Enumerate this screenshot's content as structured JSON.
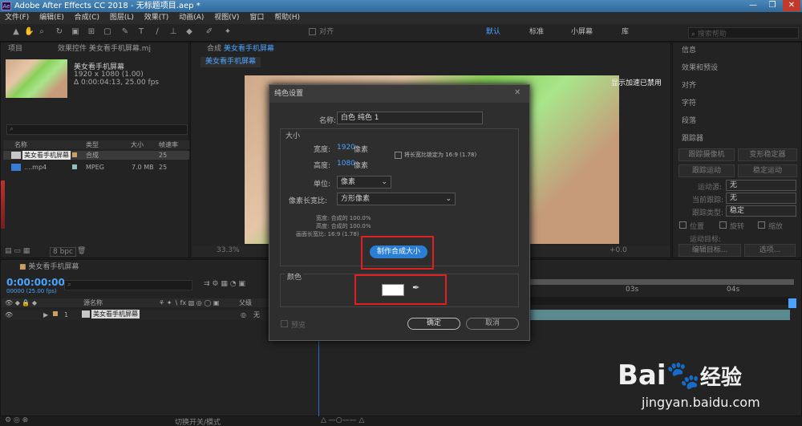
{
  "window": {
    "app_icon": "Ae",
    "title": "Adobe After Effects CC 2018 - 无标题项目.aep *",
    "minimize": "—",
    "maximize": "❐",
    "close": "✕"
  },
  "menu": [
    "文件(F)",
    "编辑(E)",
    "合成(C)",
    "图层(L)",
    "效果(T)",
    "动画(A)",
    "视图(V)",
    "窗口",
    "帮助(H)"
  ],
  "toolbar": {
    "align_label": "对齐",
    "workspaces": [
      "默认",
      "标准",
      "小屏幕",
      "库"
    ],
    "search_placeholder": "搜索帮助"
  },
  "project_panel": {
    "tab_project": "项目",
    "tab_effects": "效果控件 美女看手机屏幕.mj",
    "comp_name": "美女看手机屏幕",
    "comp_res": "1920 x 1080 (1.00)",
    "comp_dur": "Δ 0:00:04:13, 25.00 fps",
    "columns": {
      "name": "名称",
      "type": "类型",
      "size": "大小",
      "fps": "帧速率"
    },
    "items": [
      {
        "name": "美女看手机屏幕",
        "type": "合成",
        "size": "",
        "fps": "25"
      },
      {
        "name": "....mp4",
        "type": "MPEG",
        "size": "7.0 MB",
        "fps": "25"
      }
    ],
    "bpc": "8 bpc"
  },
  "comp_panel": {
    "tab_label": "合成",
    "tab_name": "美女看手机屏幕",
    "subtab": "美女看手机屏幕",
    "gpu_notice": "显示加速已禁用",
    "zoom": "33.3%",
    "exposure": "+0.0"
  },
  "right_panel": {
    "items": [
      "信息",
      "效果和预设",
      "对齐",
      "字符",
      "段落",
      "跟踪器"
    ],
    "tracker_buttons": [
      "跟踪摄像机",
      "变形稳定器",
      "跟踪运动",
      "稳定运动"
    ],
    "motion_source_label": "运动源:",
    "motion_source_value": "无",
    "current_track_label": "当前跟踪:",
    "current_track_value": "无",
    "track_type_label": "跟踪类型:",
    "track_type_value": "稳定",
    "checkboxes": [
      "位置",
      "旋转",
      "缩放"
    ],
    "motion_target_label": "运动目标:",
    "edit_target": "编辑目标...",
    "options": "选项..."
  },
  "timeline": {
    "tab_name": "美女看手机屏幕",
    "timecode": "0:00:00:00",
    "frames": "00000 (25.00 fps)",
    "col_source": "源名称",
    "col_parent": "父级",
    "layer_num": "1",
    "layer_name": "美女看手机屏幕",
    "parent_value": "无",
    "ruler_marks": [
      "03s",
      "04s"
    ],
    "toggle_label": "切换开关/模式"
  },
  "dialog": {
    "title": "纯色设置",
    "name_label": "名称:",
    "name_value": "白色 纯色 1",
    "size_section": "大小",
    "width_label": "宽度:",
    "width_value": "1920",
    "width_unit": "像素",
    "height_label": "高度:",
    "height_value": "1080",
    "height_unit": "像素",
    "lock_ratio": "将长宽比锁定为 16:9 (1.78)",
    "units_label": "单位:",
    "units_value": "像素",
    "par_label": "像素长宽比:",
    "par_value": "方形像素",
    "info_width": "宽度: 合成的 100.0%",
    "info_height": "高度: 合成的 100.0%",
    "info_ratio": "画面长宽比: 16:9 (1.78)",
    "make_comp_size": "制作合成大小",
    "color_section": "颜色",
    "preview": "预览",
    "ok": "确定",
    "cancel": "取消"
  },
  "watermark": {
    "logo_text": "Bai",
    "logo_suffix": "经验",
    "url": "jingyan.baidu.com"
  },
  "colors": {
    "accent_blue": "#4aa4ff",
    "highlight_red": "#e02020",
    "button_blue": "#2a7fd4",
    "panel_bg": "#232323"
  }
}
